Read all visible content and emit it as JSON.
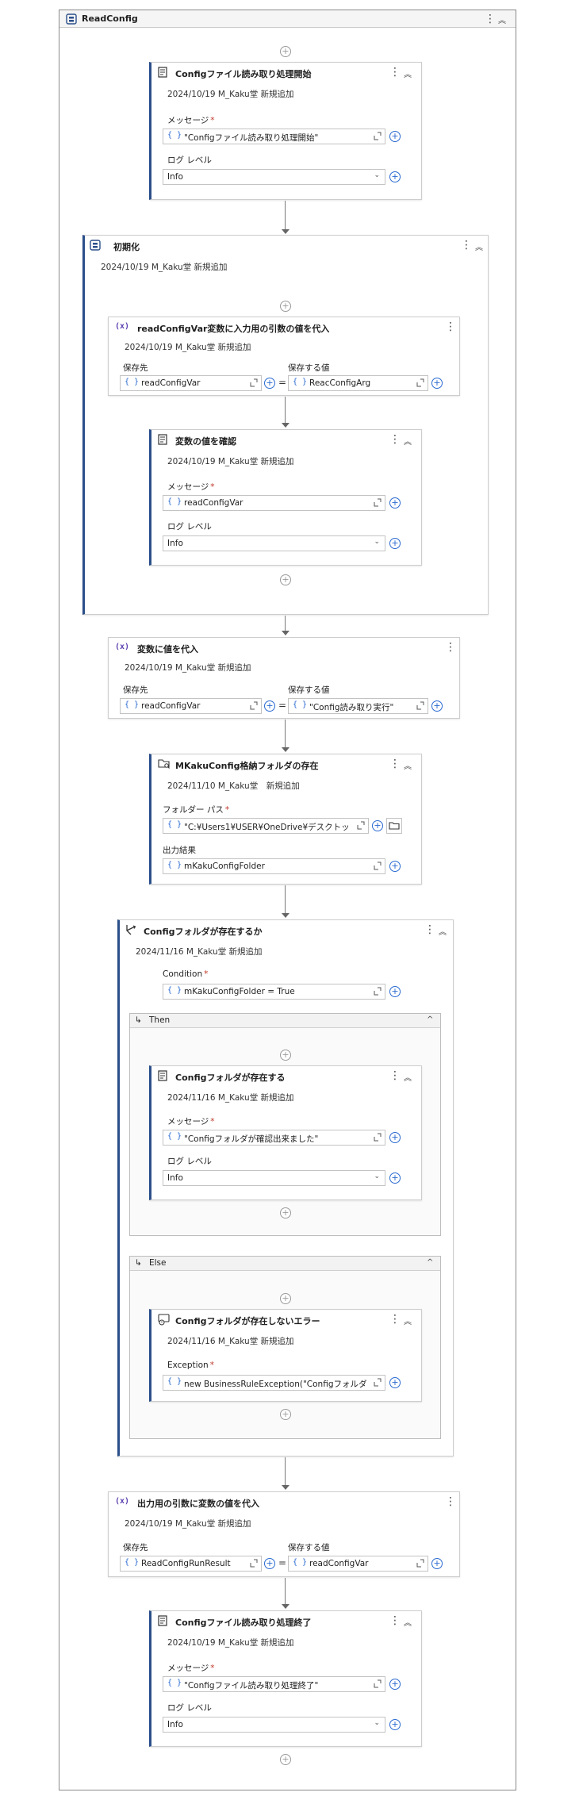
{
  "root": {
    "title": "ReadConfig"
  },
  "log_start": {
    "title": "Configファイル読み取り処理開始",
    "annotation": "2024/10/19 M_Kaku堂 新規追加",
    "message_label": "メッセージ",
    "message_value": "\"Configファイル読み取り処理開始\"",
    "level_label": "ログ レベル",
    "level_value": "Info"
  },
  "init": {
    "title": "初期化",
    "annotation": "2024/10/19 M_Kaku堂 新規追加",
    "assign": {
      "title": "readConfigVar変数に入力用の引数の値を代入",
      "annotation": "2024/10/19 M_Kaku堂 新規追加",
      "to_label": "保存先",
      "to_value": "readConfigVar",
      "value_label": "保存する値",
      "value_value": "ReacConfigArg"
    },
    "log": {
      "title": "変数の値を確認",
      "annotation": "2024/10/19 M_Kaku堂 新規追加",
      "message_label": "メッセージ",
      "message_value": "readConfigVar",
      "level_label": "ログ レベル",
      "level_value": "Info"
    }
  },
  "assign2": {
    "title": "変数に値を代入",
    "annotation": "2024/10/19 M_Kaku堂 新規追加",
    "to_label": "保存先",
    "to_value": "readConfigVar",
    "value_label": "保存する値",
    "value_value": "\"Config読み取り実行\""
  },
  "folder_exists": {
    "title": "MKakuConfig格納フォルダの存在",
    "annotation": "2024/11/10 M_Kaku堂　新規追加",
    "path_label": "フォルダー パス",
    "path_value": "\"C:¥Users1¥USER¥OneDrive¥デスクトップ",
    "result_label": "出力結果",
    "result_value": "mKakuConfigFolder"
  },
  "if": {
    "title": "Configフォルダが存在するか",
    "annotation": "2024/11/16 M_Kaku堂 新規追加",
    "condition_label": "Condition",
    "condition_value": "mKakuConfigFolder = True",
    "then_label": "Then",
    "then_log": {
      "title": "Configフォルダが存在する",
      "annotation": "2024/11/16 M_Kaku堂 新規追加",
      "message_label": "メッセージ",
      "message_value": "\"Configフォルダが確認出来ました\"",
      "level_label": "ログ レベル",
      "level_value": "Info"
    },
    "else_label": "Else",
    "else_throw": {
      "title": "Configフォルダが存在しないエラー",
      "annotation": "2024/11/16 M_Kaku堂 新規追加",
      "exception_label": "Exception",
      "exception_value": "new BusinessRuleException(\"Configフォルダ"
    }
  },
  "assign3": {
    "title": "出力用の引数に変数の値を代入",
    "annotation": "2024/10/19 M_Kaku堂 新規追加",
    "to_label": "保存先",
    "to_value": "ReadConfigRunResult",
    "value_label": "保存する値",
    "value_value": "readConfigVar"
  },
  "log_end": {
    "title": "Configファイル読み取り処理終了",
    "annotation": "2024/10/19 M_Kaku堂 新規追加",
    "message_label": "メッセージ",
    "message_value": "\"Configファイル読み取り処理終了\"",
    "level_label": "ログ レベル",
    "level_value": "Info"
  },
  "glyphs": {
    "required": "*",
    "brace": "{ }",
    "plus": "+",
    "kebab": "⋮",
    "collapse": "︽",
    "chevron_down": "⌄",
    "chevron_up": "^",
    "equals": "=",
    "var": "(x)",
    "branch_arrow": "↳"
  },
  "colors": {
    "accent": "#2b4f8a",
    "link_blue": "#2a6ad1",
    "var_purple": "#5b3fb0"
  }
}
